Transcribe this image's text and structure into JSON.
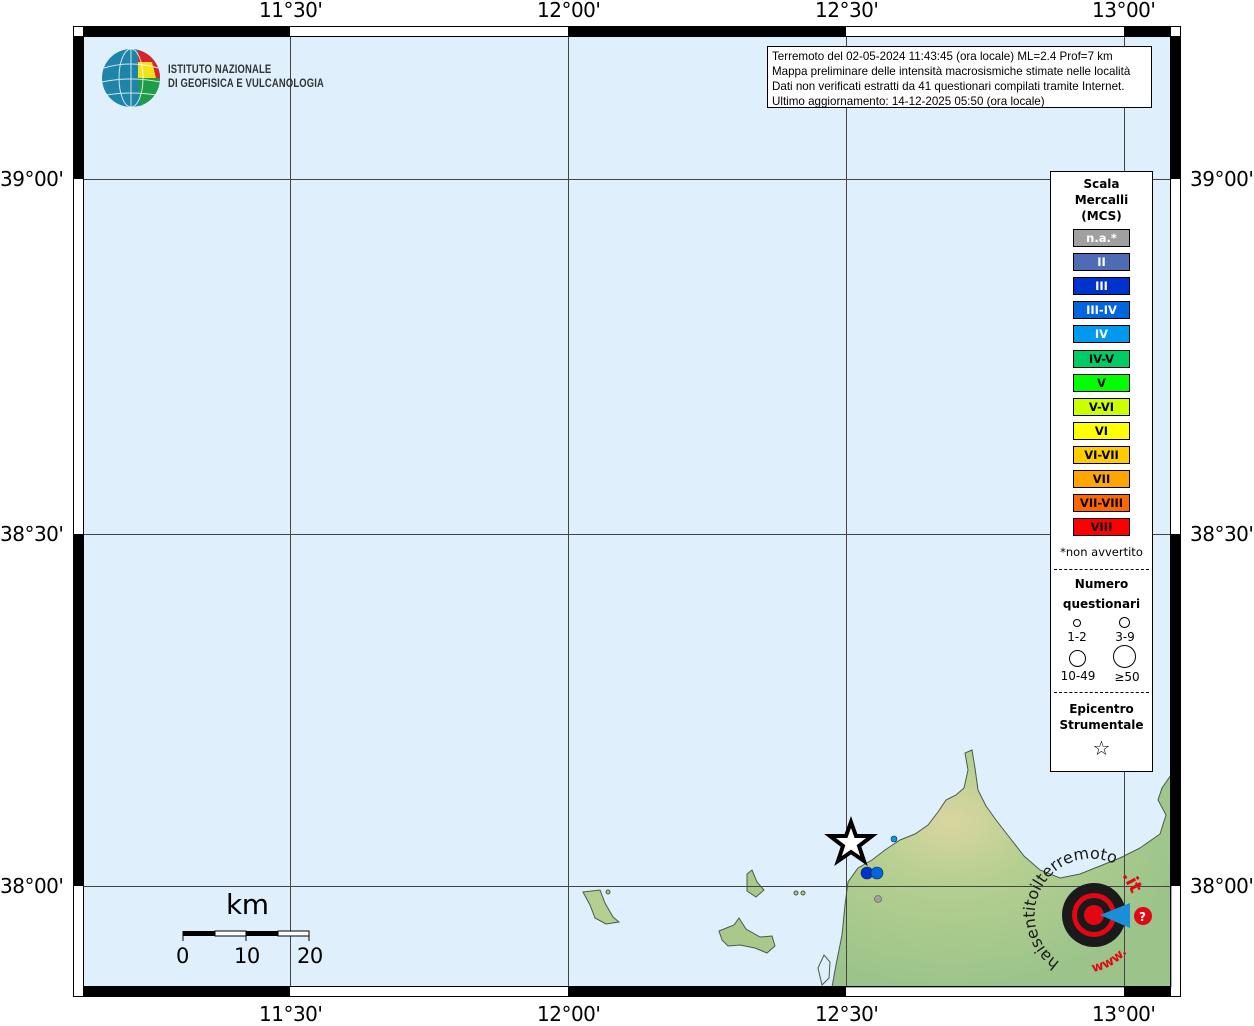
{
  "map": {
    "lon_ticks": [
      "11°30'",
      "12°00'",
      "12°30'",
      "13°00'"
    ],
    "lat_ticks": [
      "39°00'",
      "38°30'",
      "38°00'"
    ],
    "colors": {
      "sea": "#dff0fc",
      "land": "#a9c98a",
      "frame": "#000000"
    }
  },
  "logo": {
    "line1": "ISTITUTO NAZIONALE",
    "line2": "DI GEOFISICA E VULCANOLOGIA"
  },
  "info": {
    "lines": [
      "Terremoto del 02-05-2024 11:43:45 (ora locale) ML=2.4 Prof=7 km",
      "Mappa preliminare delle intensità macrosismiche stimate nelle località",
      "Dati non verificati estratti da 41 questionari compilati tramite Internet.",
      "Ultimo aggiornamento: 14-12-2025 05:50 (ora locale)"
    ]
  },
  "legend": {
    "title1": "Scala",
    "title2": "Mercalli",
    "title3": "(MCS)",
    "classes": [
      {
        "label": "n.a.*",
        "color": "#a0a0a0",
        "text": "#ffffff"
      },
      {
        "label": "II",
        "color": "#4d6cb3",
        "text": "#ffffff"
      },
      {
        "label": "III",
        "color": "#0033cc",
        "text": "#ffffff"
      },
      {
        "label": "III-IV",
        "color": "#0066dd",
        "text": "#ffffff"
      },
      {
        "label": "IV",
        "color": "#0099ee",
        "text": "#ffffff"
      },
      {
        "label": "IV-V",
        "color": "#00cc66",
        "text": "#000000"
      },
      {
        "label": "V",
        "color": "#00ff00",
        "text": "#000000"
      },
      {
        "label": "V-VI",
        "color": "#ccff00",
        "text": "#000000"
      },
      {
        "label": "VI",
        "color": "#ffff00",
        "text": "#000000"
      },
      {
        "label": "VI-VII",
        "color": "#ffcc00",
        "text": "#000000"
      },
      {
        "label": "VII",
        "color": "#ffa500",
        "text": "#000000"
      },
      {
        "label": "VII-VIII",
        "color": "#ff6600",
        "text": "#000000"
      },
      {
        "label": "VIII",
        "color": "#ff0000",
        "text": "#000000"
      }
    ],
    "note": "*non avvertito",
    "count_title1": "Numero",
    "count_title2": "questionari",
    "counts": [
      "1-2",
      "3-9",
      "10-49",
      "≥50"
    ],
    "epi_title1": "Epicentro",
    "epi_title2": "Strumentale"
  },
  "scalebar": {
    "unit": "km",
    "ticks": [
      "0",
      "10",
      "20"
    ]
  },
  "observations": [
    {
      "intensity": "III",
      "color": "#0033cc",
      "count": "1-2"
    },
    {
      "intensity": "III-IV",
      "color": "#0066dd",
      "count": "1-2"
    },
    {
      "intensity": "IV",
      "color": "#0099ee",
      "count": "1-2"
    },
    {
      "intensity": "n.a.*",
      "color": "#a0a0a0",
      "count": "1-2"
    }
  ],
  "hsit_logo": {
    "text_black": "haisentitoilterremoto",
    "text_red": ".it",
    "prefix": "www."
  }
}
